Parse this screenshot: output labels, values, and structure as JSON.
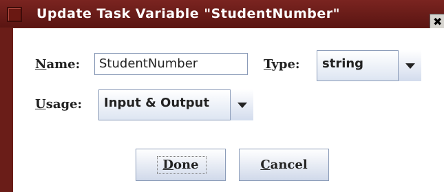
{
  "dialog": {
    "title": "Update Task Variable \"StudentNumber\"",
    "close_glyph": "✖"
  },
  "form": {
    "name_label_mnemonic": "N",
    "name_label_rest": "ame:",
    "name_value": "StudentNumber",
    "type_label_mnemonic": "T",
    "type_label_rest": "ype:",
    "type_value": "string",
    "usage_label_mnemonic": "U",
    "usage_label_rest": "sage:",
    "usage_value": "Input & Output"
  },
  "buttons": {
    "done_mnemonic": "D",
    "done_rest": "one",
    "cancel_mnemonic": "C",
    "cancel_rest": "ancel"
  },
  "icons": {
    "window": "window-menu-icon",
    "close": "close-icon",
    "dropdown": "chevron-down-icon"
  },
  "colors": {
    "titlebar": "#6a1d18",
    "control_border": "#8a9bb8",
    "control_gradient_bottom": "#d0d9ea"
  }
}
